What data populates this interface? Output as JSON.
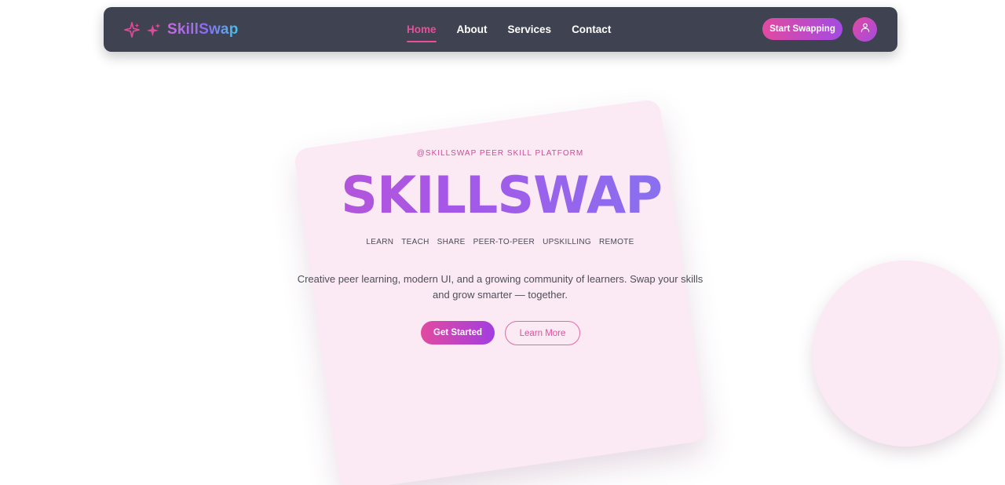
{
  "navbar": {
    "brand": "SkillSwap",
    "links": [
      "Home",
      "About",
      "Services",
      "Contact"
    ],
    "active_link": "Home",
    "cta_label": "Start Swapping"
  },
  "hero": {
    "eyebrow": "@SKILLSWAP PEER SKILL PLATFORM",
    "title": "SKILLSWAP",
    "tags": [
      "LEARN",
      "TEACH",
      "SHARE",
      "PEER-TO-PEER",
      "UPSKILLING",
      "REMOTE"
    ],
    "description": "Creative peer learning, modern UI, and a growing community of learners. Swap your skills and grow smarter — together.",
    "primary_button": "Get Started",
    "secondary_button": "Learn More"
  },
  "icons": {
    "brand_icons": [
      "sparkle-outline-icon",
      "sparkles-icon"
    ],
    "avatar_icon": "user-icon"
  },
  "colors": {
    "nav_bg": "#3f4250",
    "accent_pink": "#ec4c9a",
    "accent_purple": "#a34be2",
    "card_bg": "#fbe9f4"
  }
}
